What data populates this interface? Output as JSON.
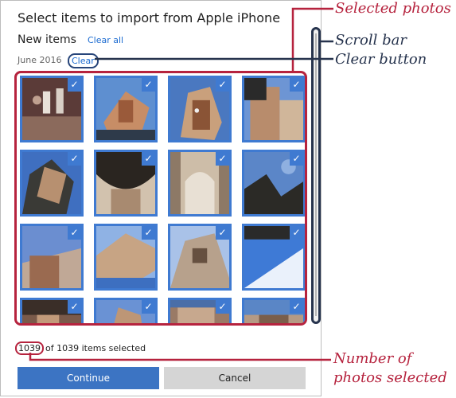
{
  "dialog": {
    "title": "Select items to import from Apple iPhone",
    "section_title": "New items",
    "clear_all_label": "Clear all",
    "date_label": "June 2016",
    "clear_label": "Clear",
    "count_selected": "1039",
    "count_suffix": "of 1039 items selected",
    "continue_label": "Continue",
    "cancel_label": "Cancel"
  },
  "thumbnails": [
    {
      "checked": true
    },
    {
      "checked": true
    },
    {
      "checked": true
    },
    {
      "checked": true
    },
    {
      "checked": true
    },
    {
      "checked": true
    },
    {
      "checked": true
    },
    {
      "checked": true
    },
    {
      "checked": true
    },
    {
      "checked": true
    },
    {
      "checked": true
    },
    {
      "checked": true
    },
    {
      "checked": true
    },
    {
      "checked": true
    },
    {
      "checked": true
    },
    {
      "checked": true
    }
  ],
  "callouts": {
    "selected_photos": "Selected photos",
    "scroll_bar": "Scroll bar",
    "clear_button": "Clear button",
    "number_line1": "Number of",
    "number_line2": "photos selected"
  },
  "colors": {
    "accent_blue": "#3f7ad1",
    "callout_red": "#b6233e",
    "callout_navy": "#26334d"
  }
}
